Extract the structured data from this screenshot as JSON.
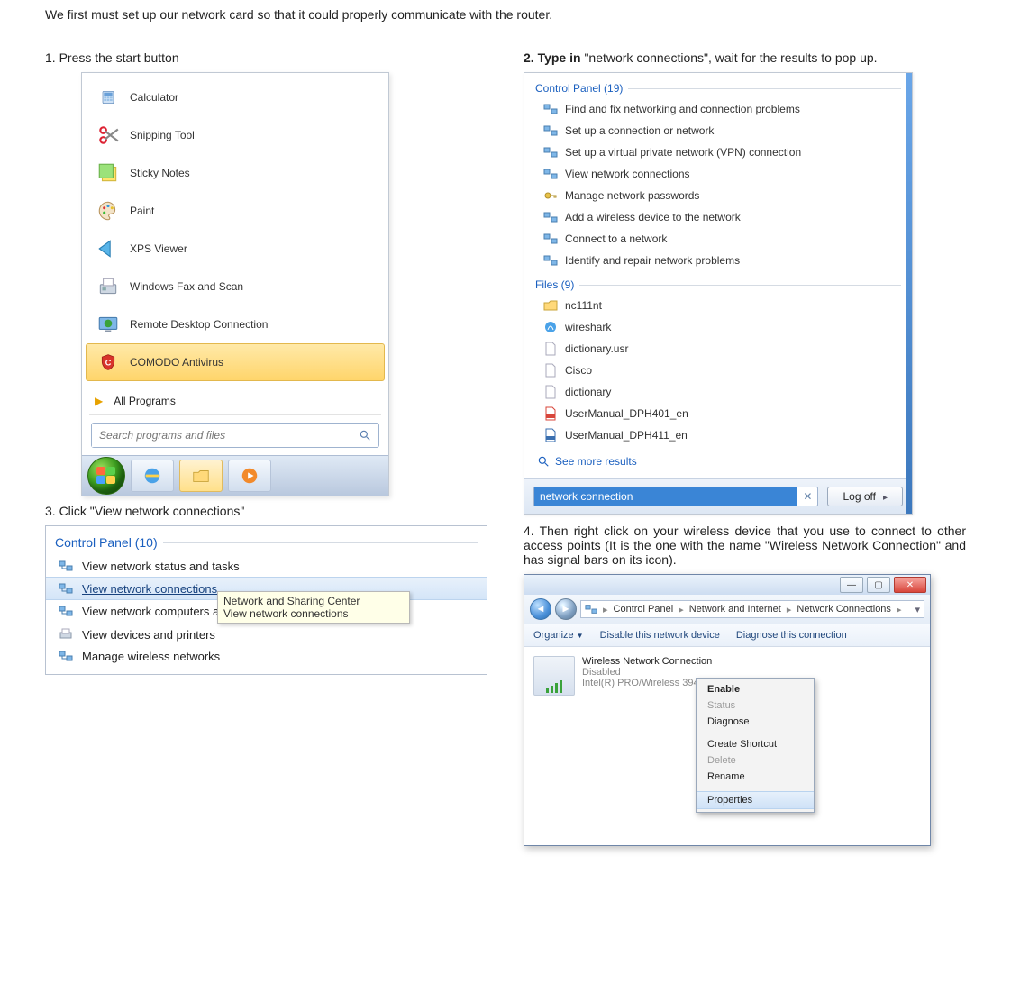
{
  "intro": "We first must set up our network card so that it could properly communicate with the router.",
  "steps": {
    "s1": "1. Press the start button",
    "s2_a": "2. Type in ",
    "s2_b": "\"network connections\", wait for the results to pop up.",
    "s3": "3. Click \"View network connections\"",
    "s4": "4. Then right click on your wireless device that you use to connect to other access points (It is the one with the name \"Wireless Network Connection\" and has signal bars on its icon)."
  },
  "startmenu": {
    "items": [
      {
        "label": "Calculator"
      },
      {
        "label": "Snipping Tool"
      },
      {
        "label": "Sticky Notes"
      },
      {
        "label": "Paint"
      },
      {
        "label": "XPS Viewer"
      },
      {
        "label": "Windows Fax and Scan"
      },
      {
        "label": "Remote Desktop Connection"
      },
      {
        "label": "COMODO Antivirus"
      }
    ],
    "all_programs": "All Programs",
    "search_placeholder": "Search programs and files"
  },
  "sr": {
    "cp_header": "Control Panel (19)",
    "cp_items": [
      "Find and fix networking and connection problems",
      "Set up a connection or network",
      "Set up a virtual private network (VPN) connection",
      "View network connections",
      "Manage network passwords",
      "Add a wireless device to the network",
      "Connect to a network",
      "Identify and repair network problems"
    ],
    "files_header": "Files (9)",
    "files": [
      "nc111nt",
      "wireshark",
      "dictionary.usr",
      "Cisco",
      "dictionary",
      "UserManual_DPH401_en",
      "UserManual_DPH411_en"
    ],
    "see_more": "See more results",
    "query": "network connection",
    "logoff": "Log off"
  },
  "cp3": {
    "header": "Control Panel (10)",
    "items": [
      "View network status and tasks",
      "View network connections",
      "View network computers a",
      "View devices and printers",
      "Manage wireless networks"
    ],
    "tooltip_l1": "Network and Sharing Center",
    "tooltip_l2": "View network connections"
  },
  "explorer": {
    "crumbs": [
      "Control Panel",
      "Network and Internet",
      "Network Connections"
    ],
    "cmds": {
      "organize": "Organize",
      "disable": "Disable this network device",
      "diagnose": "Diagnose this connection"
    },
    "conn": {
      "name": "Wireless Network Connection",
      "status": "Disabled",
      "device": "Intel(R) PRO/Wireless 3945A…"
    },
    "menu": {
      "enable": "Enable",
      "status": "Status",
      "diagnose": "Diagnose",
      "shortcut": "Create Shortcut",
      "delete": "Delete",
      "rename": "Rename",
      "props": "Properties"
    }
  }
}
